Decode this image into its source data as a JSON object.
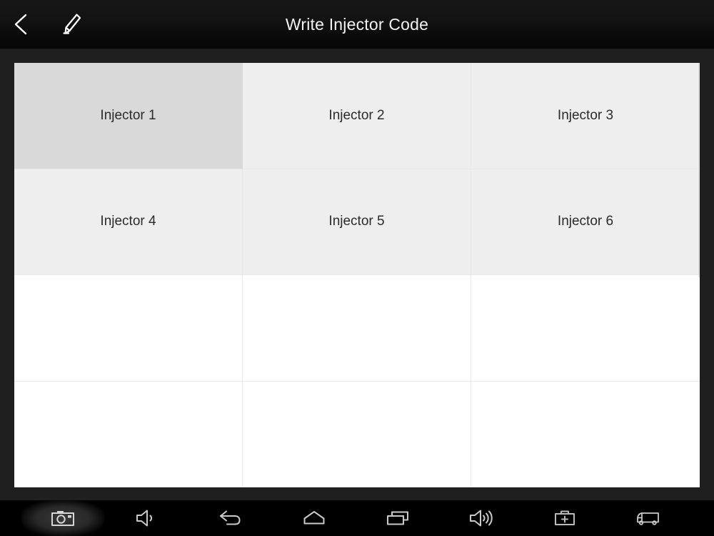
{
  "header": {
    "title": "Write Injector Code",
    "back_icon": "chevron-left-icon",
    "edit_icon": "pencil-icon"
  },
  "grid": {
    "columns": 3,
    "rows": 4,
    "selected_index": 0,
    "cells": [
      {
        "label": "Injector 1",
        "state": "selected"
      },
      {
        "label": "Injector 2",
        "state": "filled"
      },
      {
        "label": "Injector 3",
        "state": "filled"
      },
      {
        "label": "Injector 4",
        "state": "filled"
      },
      {
        "label": "Injector 5",
        "state": "filled"
      },
      {
        "label": "Injector 6",
        "state": "filled"
      },
      {
        "label": "",
        "state": "empty"
      },
      {
        "label": "",
        "state": "empty"
      },
      {
        "label": "",
        "state": "empty"
      },
      {
        "label": "",
        "state": "empty"
      },
      {
        "label": "",
        "state": "empty"
      },
      {
        "label": "",
        "state": "empty"
      }
    ]
  },
  "navbar": {
    "items": [
      {
        "icon": "camera-icon",
        "name": "screenshot-button",
        "pressed": true
      },
      {
        "icon": "volume-down-icon",
        "name": "volume-down-button",
        "pressed": false
      },
      {
        "icon": "back-arrow-icon",
        "name": "back-button",
        "pressed": false
      },
      {
        "icon": "home-icon",
        "name": "home-button",
        "pressed": false
      },
      {
        "icon": "recents-icon",
        "name": "recents-button",
        "pressed": false
      },
      {
        "icon": "volume-up-icon",
        "name": "volume-up-button",
        "pressed": false
      },
      {
        "icon": "toolbox-icon",
        "name": "toolbox-button",
        "pressed": false
      },
      {
        "icon": "truck-icon",
        "name": "vehicle-button",
        "pressed": false
      }
    ]
  },
  "colors": {
    "header_bg": "#121212",
    "page_bg": "#1f1f1f",
    "grid_bg": "#ffffff",
    "cell_filled": "#eeeeee",
    "cell_selected": "#d9d9d9",
    "cell_divider": "#e9e9e9",
    "cell_text": "#2b2b2b",
    "title_text": "#f2f2f2",
    "nav_bg": "#000000",
    "nav_icon": "#c9c9c9"
  }
}
